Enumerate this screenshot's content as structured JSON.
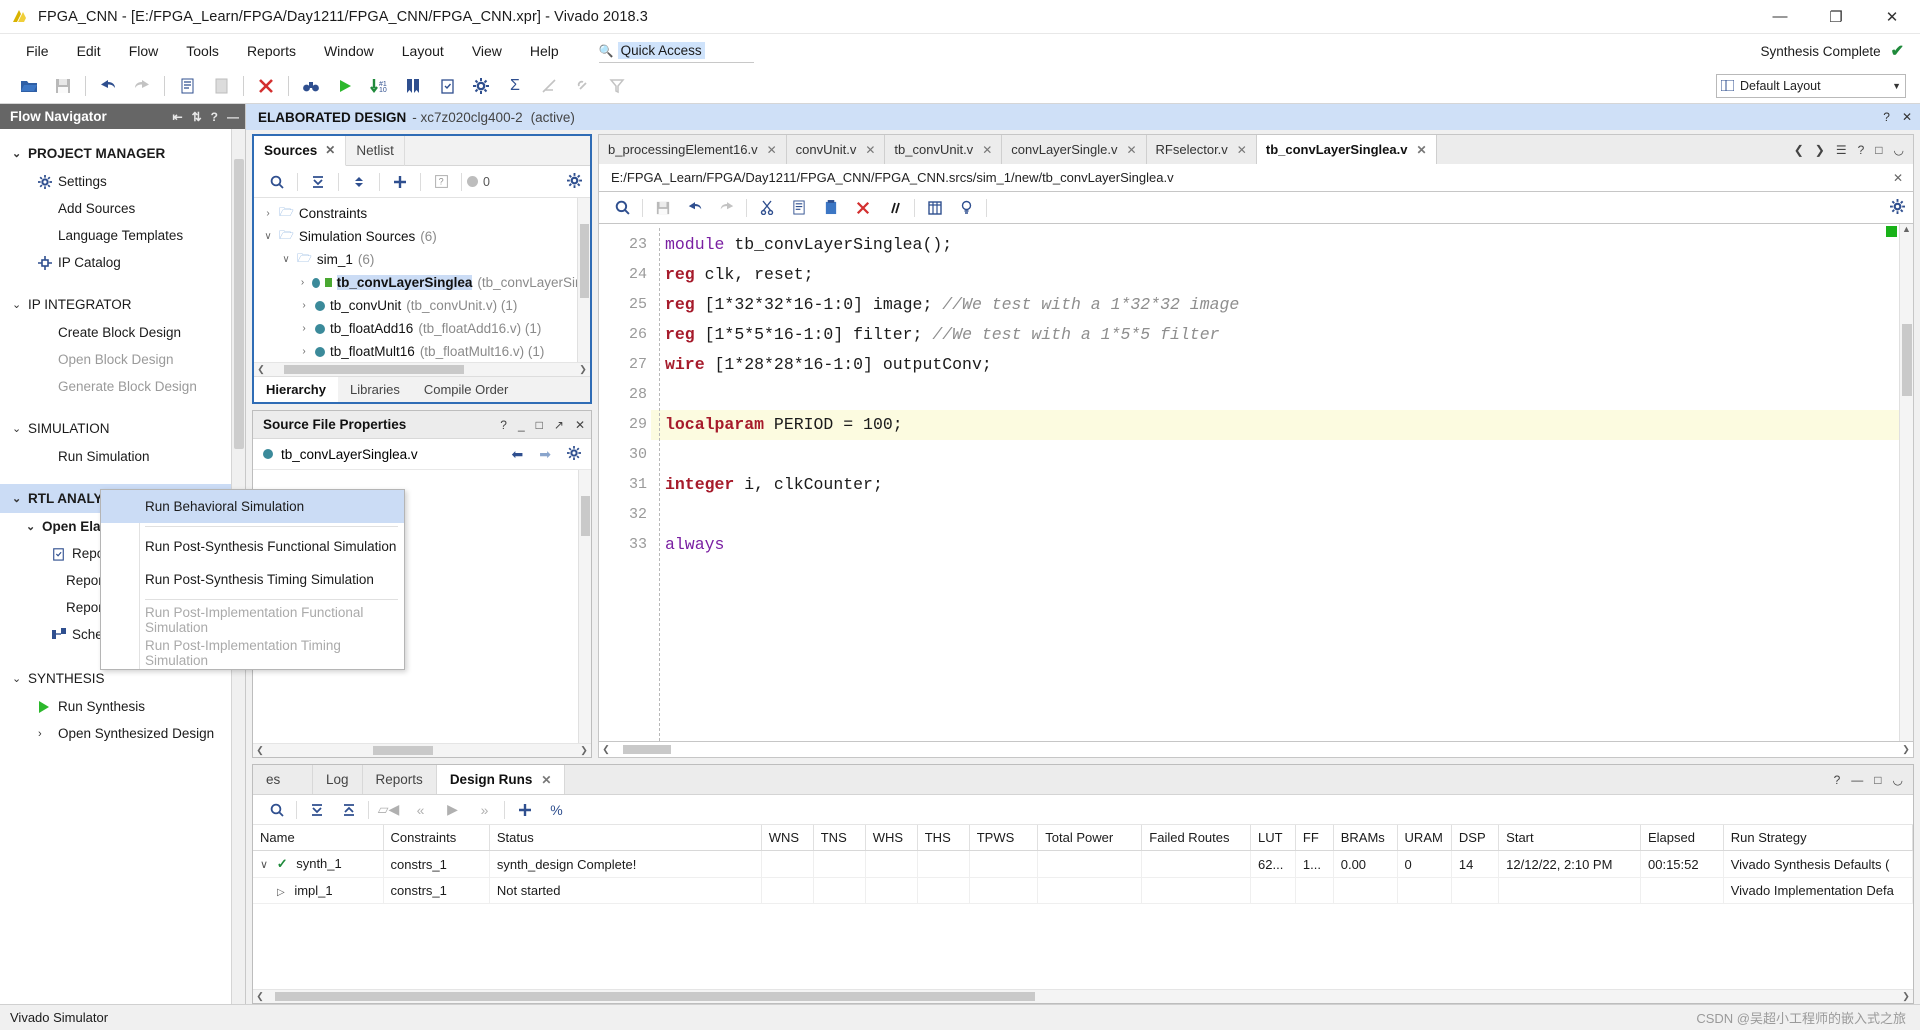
{
  "window": {
    "title": "FPGA_CNN - [E:/FPGA_Learn/FPGA/Day1211/FPGA_CNN/FPGA_CNN.xpr] - Vivado 2018.3",
    "minimize": "—",
    "maximize": "❐",
    "close": "✕"
  },
  "menubar": {
    "items": [
      "File",
      "Edit",
      "Flow",
      "Tools",
      "Reports",
      "Window",
      "Layout",
      "View",
      "Help"
    ],
    "quick_access_placeholder": "Quick Access",
    "status_text": "Synthesis Complete",
    "status_check": "✔"
  },
  "toolbar": {
    "layout_label": "Default Layout",
    "buttons": [
      "open-icon",
      "save-icon",
      "undo-icon",
      "redo-icon",
      "copy-icon",
      "paste-icon",
      "cancel-icon",
      "search-icon",
      "run-icon",
      "step-icon",
      "bookmark-icon",
      "checklist-icon",
      "settings-icon",
      "sum-icon",
      "report-icon",
      "link-icon",
      "filter-icon"
    ]
  },
  "flow_navigator": {
    "title": "Flow Navigator",
    "sections": [
      {
        "label": "PROJECT MANAGER",
        "bold": true,
        "items": [
          {
            "label": "Settings",
            "icon": "gear-icon",
            "dim": false
          },
          {
            "label": "Add Sources",
            "icon": "",
            "dim": false
          },
          {
            "label": "Language Templates",
            "icon": "",
            "dim": false
          },
          {
            "label": "IP Catalog",
            "icon": "ip-icon",
            "dim": false
          }
        ]
      },
      {
        "label": "IP INTEGRATOR",
        "bold": false,
        "items": [
          {
            "label": "Create Block Design",
            "icon": "",
            "dim": false
          },
          {
            "label": "Open Block Design",
            "icon": "",
            "dim": true
          },
          {
            "label": "Generate Block Design",
            "icon": "",
            "dim": true
          }
        ]
      },
      {
        "label": "SIMULATION",
        "bold": false,
        "items": [
          {
            "label": "Run Simulation",
            "icon": "",
            "dim": false
          }
        ]
      },
      {
        "label": "RTL ANALYSIS",
        "bold": true,
        "selected": true,
        "sub": "Open Elaborated Design",
        "items": [
          {
            "label": "Report Methodology",
            "icon": "checklist-icon",
            "dim": false
          },
          {
            "label": "Report DRC",
            "icon": "",
            "dim": false
          },
          {
            "label": "Report Noise",
            "icon": "",
            "dim": false
          },
          {
            "label": "Schematic",
            "icon": "schematic-icon",
            "dim": false
          }
        ]
      },
      {
        "label": "SYNTHESIS",
        "bold": false,
        "items": [
          {
            "label": "Run Synthesis",
            "icon": "play-icon",
            "dim": false
          },
          {
            "label": "Open Synthesized Design",
            "icon": "chevron-right-icon",
            "dim": false
          }
        ]
      }
    ]
  },
  "elaborated_bar": {
    "title": "ELABORATED DESIGN",
    "part": "- xc7z020clg400-2",
    "state": "(active)",
    "help": "?",
    "close": "✕"
  },
  "sources_panel": {
    "tabs": [
      {
        "label": "Sources",
        "active": true,
        "closable": true
      },
      {
        "label": "Netlist",
        "active": false,
        "closable": false
      }
    ],
    "toolbar_badge": "0",
    "tree": [
      {
        "indent": 0,
        "chev": "›",
        "icon": "folder",
        "name": "Constraints",
        "detail": "",
        "bold": false,
        "selected": false
      },
      {
        "indent": 0,
        "chev": "∨",
        "icon": "folder",
        "name": "Simulation Sources",
        "detail": "(6)",
        "bold": false,
        "selected": false
      },
      {
        "indent": 1,
        "chev": "∨",
        "icon": "folder",
        "name": "sim_1",
        "detail": "(6)",
        "bold": false,
        "selected": false
      },
      {
        "indent": 2,
        "chev": "›",
        "icon": "file-green",
        "name": "tb_convLayerSinglea",
        "detail": "(tb_convLayerSing",
        "bold": true,
        "selected": true
      },
      {
        "indent": 2,
        "chev": "›",
        "icon": "file",
        "name": "tb_convUnit",
        "detail": "(tb_convUnit.v) (1)",
        "bold": false,
        "selected": false
      },
      {
        "indent": 2,
        "chev": "›",
        "icon": "file",
        "name": "tb_floatAdd16",
        "detail": "(tb_floatAdd16.v) (1)",
        "bold": false,
        "selected": false
      },
      {
        "indent": 2,
        "chev": "›",
        "icon": "file",
        "name": "tb_floatMult16",
        "detail": "(tb_floatMult16.v) (1)",
        "bold": false,
        "selected": false
      }
    ],
    "bottom_tabs": [
      {
        "label": "Hierarchy",
        "active": true
      },
      {
        "label": "Libraries",
        "active": false
      },
      {
        "label": "Compile Order",
        "active": false
      }
    ]
  },
  "source_file_properties": {
    "title": "Source File Properties",
    "file": "tb_convLayerSinglea.v",
    "help": "?",
    "minimize": "_",
    "maximize": "□",
    "float": "↗",
    "close": "✕"
  },
  "editor": {
    "tabs": [
      {
        "label": "b_processingElement16.v",
        "active": false
      },
      {
        "label": "convUnit.v",
        "active": false
      },
      {
        "label": "tb_convUnit.v",
        "active": false
      },
      {
        "label": "convLayerSingle.v",
        "active": false
      },
      {
        "label": "RFselector.v",
        "active": false
      },
      {
        "label": "tb_convLayerSinglea.v",
        "active": true
      }
    ],
    "path": "E:/FPGA_Learn/FPGA/Day1211/FPGA_CNN/FPGA_CNN.srcs/sim_1/new/tb_convLayerSinglea.v",
    "lines": [
      {
        "num": "23",
        "fold": true,
        "hl": false,
        "segments": [
          {
            "t": "module ",
            "c": "kw-purple"
          },
          {
            "t": "tb_convLayerSinglea();",
            "c": "kw-black"
          }
        ]
      },
      {
        "num": "24",
        "fold": false,
        "hl": false,
        "segments": [
          {
            "t": "reg ",
            "c": "kw-red"
          },
          {
            "t": "clk, reset;",
            "c": "kw-black"
          }
        ]
      },
      {
        "num": "25",
        "fold": false,
        "hl": false,
        "segments": [
          {
            "t": "reg ",
            "c": "kw-red"
          },
          {
            "t": "[1*32*32*16-1:0] image; ",
            "c": "kw-black"
          },
          {
            "t": "//We test with a 1*32*32 image",
            "c": "comment"
          }
        ]
      },
      {
        "num": "26",
        "fold": false,
        "hl": false,
        "segments": [
          {
            "t": "reg ",
            "c": "kw-red"
          },
          {
            "t": "[1*5*5*16-1:0] filter; ",
            "c": "kw-black"
          },
          {
            "t": "//We test with a 1*5*5 filter",
            "c": "comment"
          }
        ]
      },
      {
        "num": "27",
        "fold": false,
        "hl": false,
        "segments": [
          {
            "t": "wire ",
            "c": "kw-red"
          },
          {
            "t": "[1*28*28*16-1:0] outputConv;",
            "c": "kw-black"
          }
        ]
      },
      {
        "num": "28",
        "fold": false,
        "hl": false,
        "segments": [
          {
            "t": "",
            "c": "kw-black"
          }
        ]
      },
      {
        "num": "29",
        "fold": false,
        "hl": true,
        "segments": [
          {
            "t": "localparam ",
            "c": "kw-red"
          },
          {
            "t": "PERIOD = 100;",
            "c": "kw-black"
          }
        ]
      },
      {
        "num": "30",
        "fold": false,
        "hl": false,
        "segments": [
          {
            "t": "",
            "c": "kw-black"
          }
        ]
      },
      {
        "num": "31",
        "fold": false,
        "hl": false,
        "segments": [
          {
            "t": "integer ",
            "c": "kw-red"
          },
          {
            "t": "i, clkCounter;",
            "c": "kw-black"
          }
        ]
      },
      {
        "num": "32",
        "fold": false,
        "hl": false,
        "segments": [
          {
            "t": "",
            "c": "kw-black"
          }
        ]
      },
      {
        "num": "33",
        "fold": true,
        "hl": false,
        "segments": [
          {
            "t": "always",
            "c": "kw-purple"
          }
        ]
      }
    ]
  },
  "context_menu": {
    "items": [
      {
        "label": "Run Behavioral Simulation",
        "dim": false,
        "highlight": true,
        "separator_after": true
      },
      {
        "label": "Run Post-Synthesis Functional Simulation",
        "dim": false,
        "highlight": false,
        "separator_after": false
      },
      {
        "label": "Run Post-Synthesis Timing Simulation",
        "dim": false,
        "highlight": false,
        "separator_after": true
      },
      {
        "label": "Run Post-Implementation Functional Simulation",
        "dim": true,
        "highlight": false,
        "separator_after": false
      },
      {
        "label": "Run Post-Implementation Timing Simulation",
        "dim": true,
        "highlight": false,
        "separator_after": false
      }
    ]
  },
  "bottom_dock": {
    "tabs": [
      {
        "label": "Messages",
        "active": false,
        "truncated": "es"
      },
      {
        "label": "Log",
        "active": false
      },
      {
        "label": "Reports",
        "active": false
      },
      {
        "label": "Design Runs",
        "active": true
      }
    ],
    "columns": [
      "Name",
      "Constraints",
      "Status",
      "WNS",
      "TNS",
      "WHS",
      "THS",
      "TPWS",
      "Total Power",
      "Failed Routes",
      "LUT",
      "FF",
      "BRAMs",
      "URAM",
      "DSP",
      "Start",
      "Elapsed",
      "Run Strategy"
    ],
    "rows": [
      {
        "expander": "∨",
        "status_icon": "check-green",
        "name": "synth_1",
        "constraints": "constrs_1",
        "status": "synth_design Complete!",
        "wns": "",
        "tns": "",
        "whs": "",
        "ths": "",
        "tpws": "",
        "total_power": "",
        "failed_routes": "",
        "lut": "62...",
        "ff": "1...",
        "brams": "0.00",
        "uram": "0",
        "dsp": "14",
        "start": "12/12/22, 2:10 PM",
        "elapsed": "00:15:52",
        "strategy": "Vivado Synthesis Defaults ("
      },
      {
        "expander": "▷",
        "status_icon": "",
        "name": "impl_1",
        "constraints": "constrs_1",
        "status": "Not started",
        "wns": "",
        "tns": "",
        "whs": "",
        "ths": "",
        "tpws": "",
        "total_power": "",
        "failed_routes": "",
        "lut": "",
        "ff": "",
        "brams": "",
        "uram": "",
        "dsp": "",
        "start": "",
        "elapsed": "",
        "strategy": "Vivado Implementation Defa"
      }
    ]
  },
  "statusbar": {
    "text": "Vivado Simulator",
    "watermark": "CSDN @吴超小工程师的嵌入式之旅"
  }
}
